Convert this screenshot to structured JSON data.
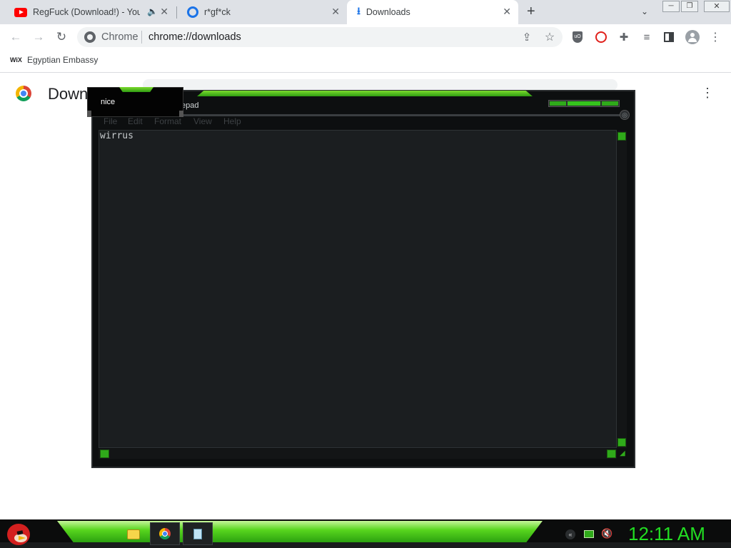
{
  "browser": {
    "tabs": [
      {
        "title": "RegFuck (Download!) - YouT",
        "icon": "youtube-icon"
      },
      {
        "title": "r*gf*ck",
        "icon": "site-favicon"
      },
      {
        "title": "Downloads",
        "icon": "download-icon",
        "active": true
      }
    ],
    "new_tab": "+",
    "address": {
      "site": "Chrome",
      "url": "chrome://downloads"
    },
    "bookmarks": [
      {
        "label": "Egyptian Embassy",
        "icon_text": "WiX"
      }
    ]
  },
  "downloads_page": {
    "title_fragment": "Down"
  },
  "tooltip": {
    "text": "nice"
  },
  "notepad": {
    "title_fragment": "epad",
    "menu": [
      "File",
      "Edit",
      "Format",
      "View",
      "Help"
    ],
    "content": "wirrus"
  },
  "taskbar": {
    "clock": "12:11 AM"
  },
  "colors": {
    "accent_green": "#33cc22",
    "clock_green": "#22dd22"
  }
}
